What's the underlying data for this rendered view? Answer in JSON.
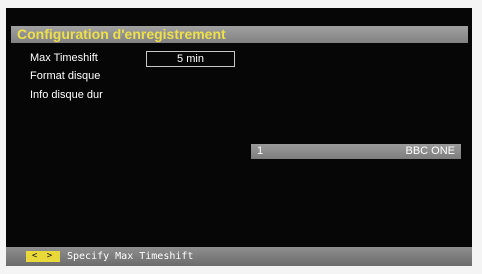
{
  "menu": {
    "title": "Configuration d'enregistrement",
    "items": [
      {
        "label": "Max Timeshift",
        "value": "5 min"
      },
      {
        "label": "Format disque"
      },
      {
        "label": "Info disque dur"
      }
    ]
  },
  "channel": {
    "number": "1",
    "name": "BBC ONE"
  },
  "hint": {
    "keys": "< >",
    "text": "Specify Max Timeshift"
  },
  "colors": {
    "title_text": "#ede04a",
    "title_bar": "#8e8e8e",
    "background": "#060606",
    "key_icon": "#e8d83a"
  }
}
